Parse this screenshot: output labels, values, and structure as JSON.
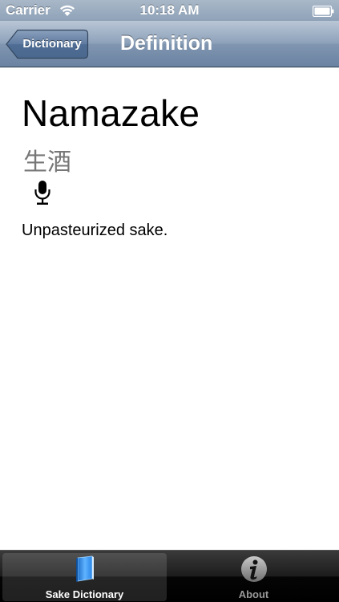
{
  "status_bar": {
    "carrier": "Carrier",
    "time": "10:18 AM",
    "wifi_icon": "wifi-icon",
    "battery_icon": "battery-icon"
  },
  "nav_bar": {
    "back_label": "Dictionary",
    "title": "Definition"
  },
  "entry": {
    "term": "Namazake",
    "kanji": "生酒",
    "audio_icon": "microphone-icon",
    "definition": "Unpasteurized sake."
  },
  "tab_bar": {
    "tabs": [
      {
        "label": "Sake Dictionary",
        "icon": "book-icon",
        "selected": true
      },
      {
        "label": "About",
        "icon": "info-icon",
        "selected": false
      }
    ]
  },
  "colors": {
    "nav_bar": "#7f95b0",
    "status_bar": "#9aabbf",
    "tab_bar": "#000000",
    "kanji_text": "#777777"
  }
}
